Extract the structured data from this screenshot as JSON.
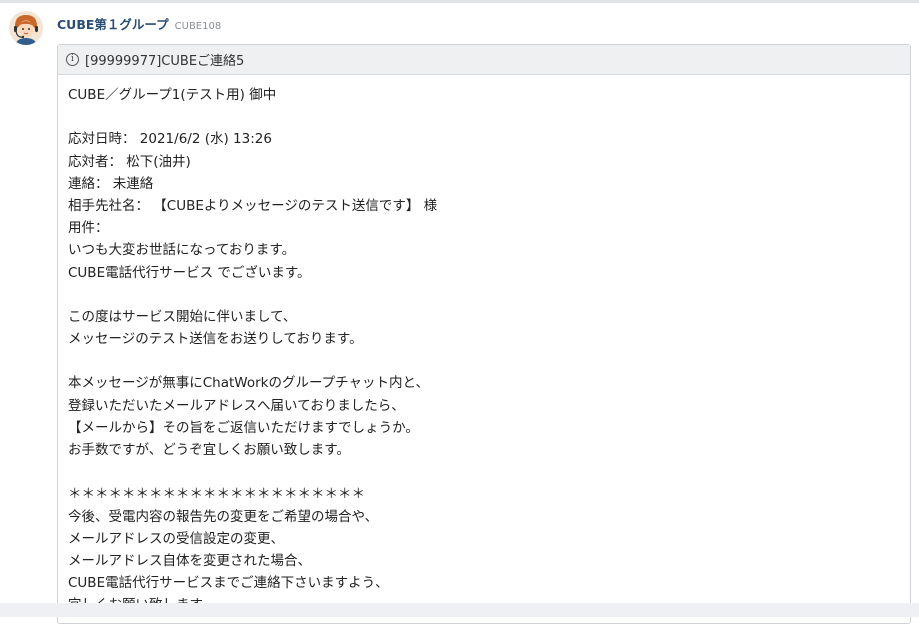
{
  "message": {
    "sender_name": "CUBE第１グループ",
    "sender_id": "CUBE108",
    "avatar_icon": "operator-avatar-icon",
    "info_icon": "info-icon",
    "title": "[99999977]CUBEご連絡5",
    "lines": [
      "CUBE／グループ1(テスト用) 御中",
      "",
      "応対日時： 2021/6/2 (水) 13:26",
      "応対者： 松下(油井)",
      "連絡： 未連絡",
      "相手先社名： 【CUBEよりメッセージのテスト送信です】 様",
      "用件：",
      "いつも大変お世話になっております。",
      "CUBE電話代行サービス でございます。",
      "",
      "この度はサービス開始に伴いまして、",
      "メッセージのテスト送信をお送りしております。",
      "",
      "本メッセージが無事にChatWorkのグループチャット内と、",
      "登録いただいたメールアドレスへ届いておりましたら、",
      "【メールから】その旨をご返信いただけますでしょうか。",
      "お手数ですが、どうぞ宜しくお願い致します。",
      "",
      "＊＊＊＊＊＊＊＊＊＊＊＊＊＊＊＊＊＊＊＊＊＊",
      "今後、受電内容の報告先の変更をご希望の場合や、",
      "メールアドレスの受信設定の変更、",
      "メールアドレス自体を変更された場合、",
      "CUBE電話代行サービスまでご連絡下さいますよう、",
      "宜しくお願い致します。"
    ]
  }
}
